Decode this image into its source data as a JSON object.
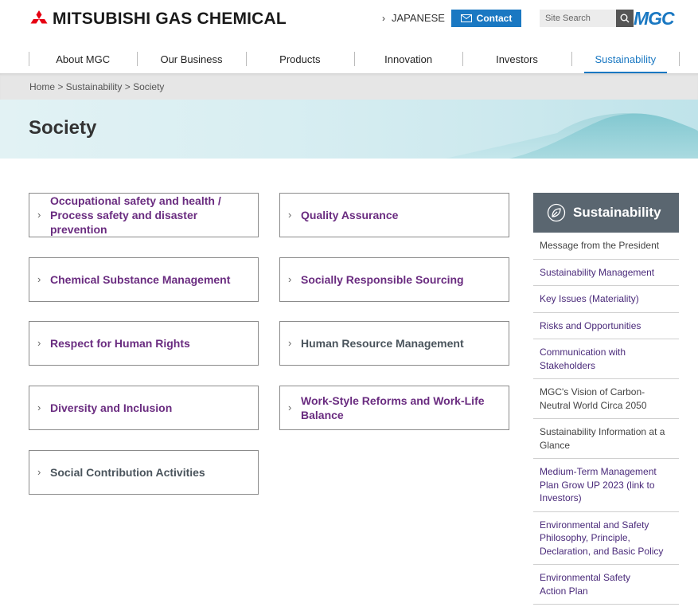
{
  "header": {
    "logo_text": "MITSUBISHI GAS CHEMICAL",
    "language_label": "JAPANESE",
    "contact_label": "Contact",
    "search_placeholder": "Site Search",
    "brand_mark": "MGC"
  },
  "nav": {
    "items": [
      {
        "label": "About MGC"
      },
      {
        "label": "Our Business"
      },
      {
        "label": "Products"
      },
      {
        "label": "Innovation"
      },
      {
        "label": "Investors"
      },
      {
        "label": "Sustainability",
        "active": true
      }
    ]
  },
  "breadcrumb": "Home > Sustainability > Society",
  "page_title": "Society",
  "cards": [
    {
      "label": "Occupational safety and health / Process safety and disaster prevention",
      "color": "#6a2c80"
    },
    {
      "label": "Quality Assurance",
      "color": "#6a2c80"
    },
    {
      "label": "Chemical Substance Management",
      "color": "#6a2c80"
    },
    {
      "label": "Socially Responsible Sourcing",
      "color": "#6a2c80"
    },
    {
      "label": "Respect for Human Rights",
      "color": "#6a2c80"
    },
    {
      "label": "Human Resource Management",
      "color": "#4a545c"
    },
    {
      "label": "Diversity and Inclusion",
      "color": "#6a2c80"
    },
    {
      "label": "Work-Style Reforms and Work-Life Balance",
      "color": "#6a2c80"
    },
    {
      "label": "Social Contribution Activities",
      "color": "#4a545c"
    }
  ],
  "sidebar": {
    "title": "Sustainability",
    "items": [
      {
        "label": "Message from the President"
      },
      {
        "label": "Sustainability Management"
      },
      {
        "label": "Key Issues (Materiality)"
      },
      {
        "label": "Risks and Opportunities"
      },
      {
        "label": "Communication with Stakeholders"
      },
      {
        "label": "MGC's Vision of Carbon-Neutral World Circa 2050"
      },
      {
        "label": "Sustainability Information at a Glance"
      },
      {
        "label": "Medium-Term Management Plan Grow UP 2023 (link to Investors)"
      },
      {
        "label": "Environmental and Safety Philosophy, Principle, Declaration, and Basic Policy"
      },
      {
        "label": "Environmental Safety Action Plan"
      }
    ]
  },
  "colors": {
    "accent_blue": "#1a78c2",
    "link_purple": "#6a2c80",
    "sidebar_header": "#5a6670",
    "logo_red": "#e60012"
  },
  "icons": [
    "three-diamonds-logo-icon",
    "chevron-right-icon",
    "mail-icon",
    "search-icon",
    "leaf-icon"
  ]
}
